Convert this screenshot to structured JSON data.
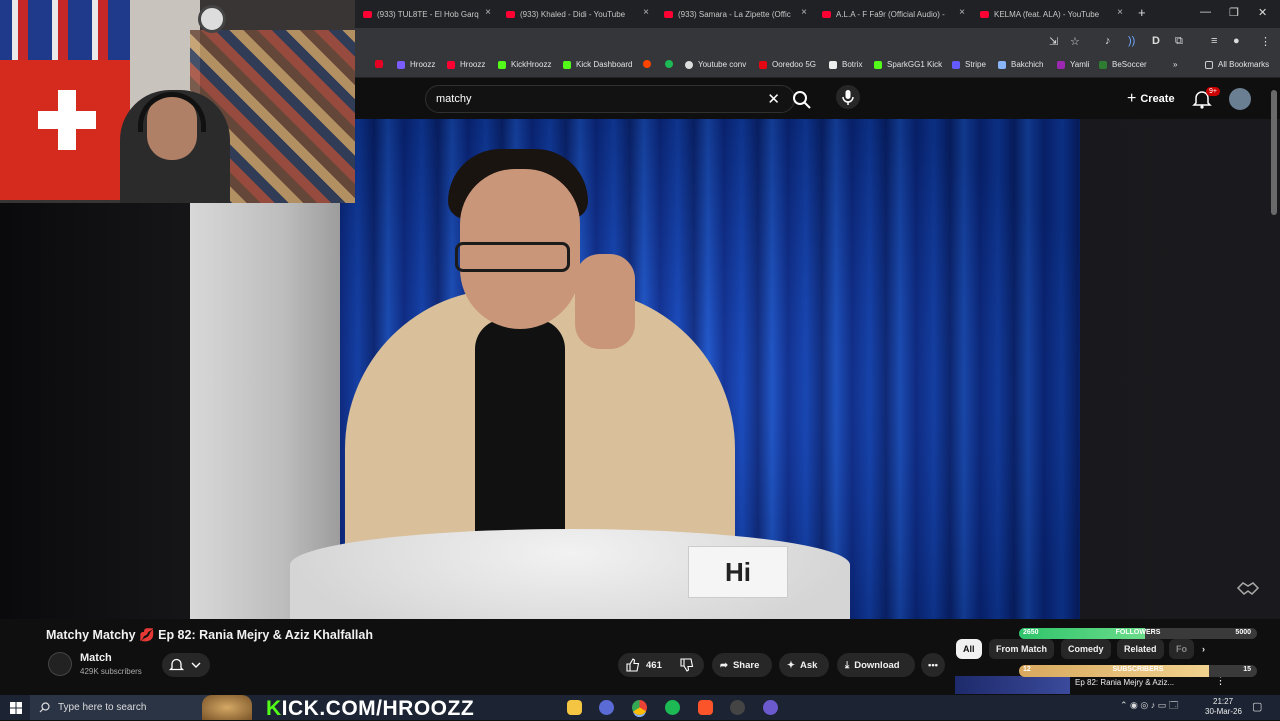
{
  "browser": {
    "tabs": [
      {
        "label": "(933) TUL8TE - El Hob Garq"
      },
      {
        "label": "(933) Khaled - Didi - YouTube"
      },
      {
        "label": "(933) Samara - La Zipette (Offic"
      },
      {
        "label": "A.L.A - F Fa9r (Official Audio) -"
      },
      {
        "label": "KELMA (feat. ALA) - YouTube"
      }
    ],
    "new_tab": "+",
    "bookmarks": [
      {
        "label": "Hroozz"
      },
      {
        "label": "Hroozz"
      },
      {
        "label": "KickHroozz"
      },
      {
        "label": "Kick Dashboard"
      },
      {
        "label": "Youtube conv"
      },
      {
        "label": "Ooredoo 5G"
      },
      {
        "label": "Botrix"
      },
      {
        "label": "SparkGG1 Kick"
      },
      {
        "label": "Stripe"
      },
      {
        "label": "Bakchich"
      },
      {
        "label": "Yamli"
      },
      {
        "label": "BeSoccer"
      }
    ],
    "all_bookmarks": "All Bookmarks"
  },
  "youtube": {
    "search_value": "matchy",
    "create_label": "Create",
    "notif_badge": "9+",
    "video": {
      "name_card": "Hi",
      "title": "Matchy Matchy 💋 Ep 82: Rania Mejry & Aziz Khalfallah",
      "channel": "Match",
      "subscribers": "429K subscribers",
      "likes": "461",
      "share": "Share",
      "ask": "Ask",
      "download": "Download"
    },
    "chips": [
      "All",
      "From Match",
      "Comedy",
      "Related",
      "Fo"
    ],
    "next_video_title": "Ep 82: Rania Mejry & Aziz..."
  },
  "overlay": {
    "followers": {
      "label": "FOLLOWERS",
      "current": "2650",
      "goal": "5000",
      "fraction": 0.53
    },
    "subscribers": {
      "label": "SUBSCRIBERS",
      "current": "12",
      "goal": "15",
      "fraction": 0.8
    },
    "kick_prefix": "K",
    "kick_url_rest": "ICK.COM/HROOZZ"
  },
  "taskbar": {
    "search_placeholder": "Type here to search",
    "time": "21:27",
    "date": "30-Mar-26"
  },
  "colors": {
    "youtube_red": "#ff0033",
    "kick_green": "#53fc18"
  }
}
